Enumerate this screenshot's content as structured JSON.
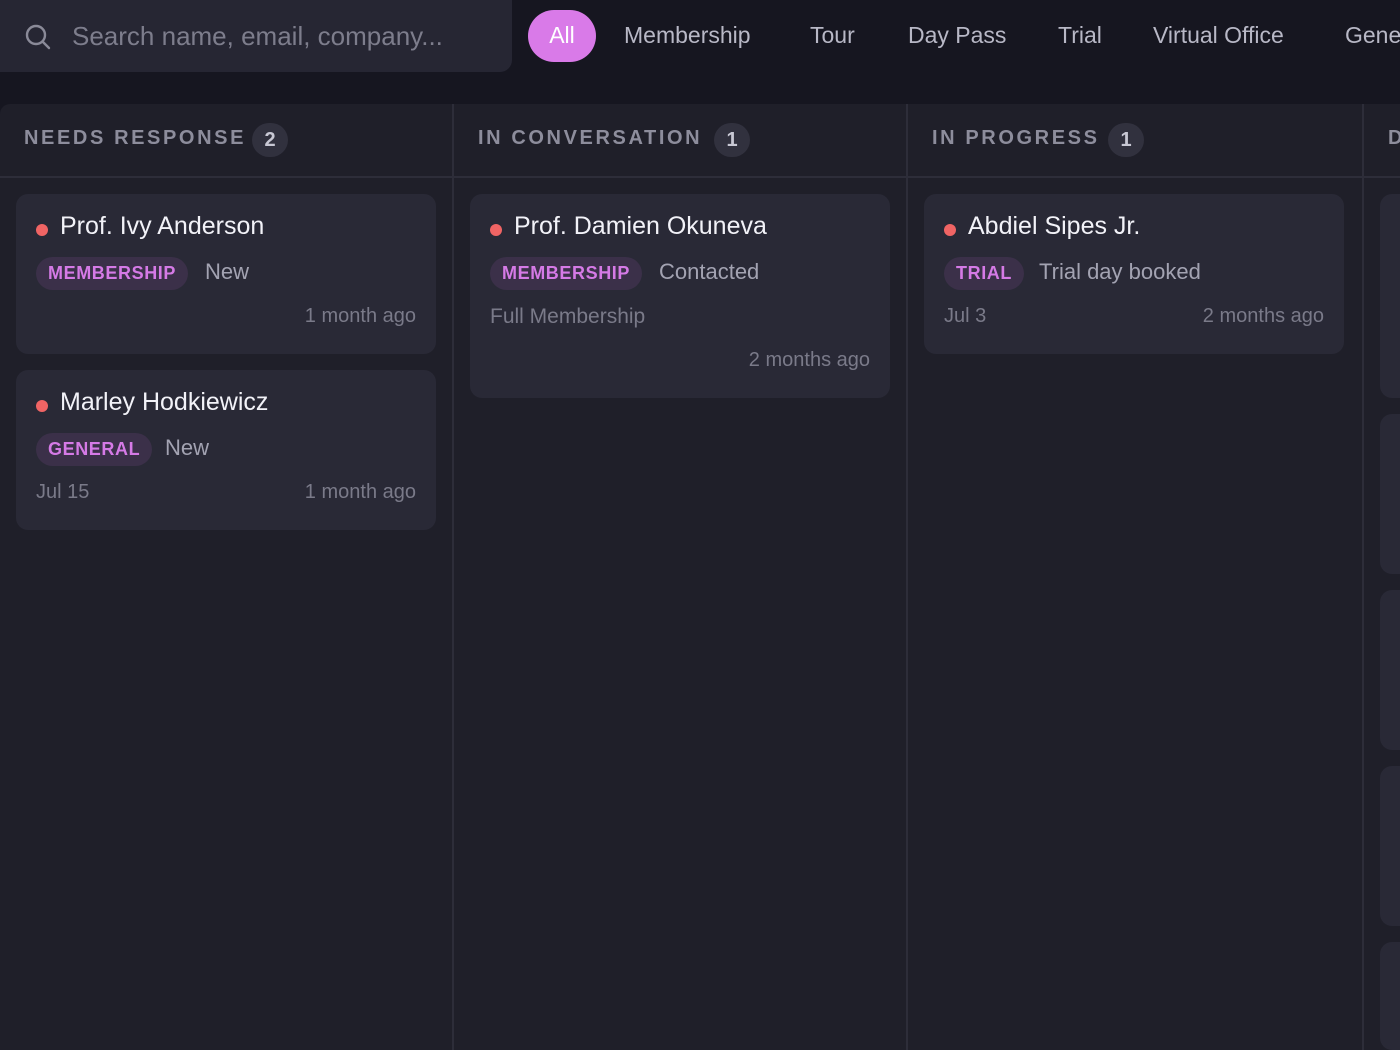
{
  "search": {
    "placeholder": "Search name, email, company..."
  },
  "filters": [
    "All",
    "Membership",
    "Tour",
    "Day Pass",
    "Trial",
    "Virtual Office",
    "Gene"
  ],
  "columns": [
    {
      "title": "NEEDS RESPONSE",
      "count": "2",
      "cards": [
        {
          "name": "Prof. Ivy Anderson",
          "tag": "MEMBERSHIP",
          "status": "New",
          "date": "",
          "ago": "1 month ago"
        },
        {
          "name": "Marley Hodkiewicz",
          "tag": "GENERAL",
          "status": "New",
          "date": "Jul 15",
          "ago": "1 month ago"
        }
      ]
    },
    {
      "title": "IN CONVERSATION",
      "count": "1",
      "cards": [
        {
          "name": "Prof. Damien Okuneva",
          "tag": "MEMBERSHIP",
          "status": "Contacted",
          "note": "Full Membership",
          "ago": "2 months ago"
        }
      ]
    },
    {
      "title": "IN PROGRESS",
      "count": "1",
      "cards": [
        {
          "name": "Abdiel Sipes Jr.",
          "tag": "TRIAL",
          "status": "Trial day booked",
          "date": "Jul 3",
          "ago": "2 months ago"
        }
      ]
    },
    {
      "title": "D"
    }
  ],
  "colors": {
    "accent": "#d97ae8",
    "unread_dot": "#f06464",
    "tag_text": "#d57ae6"
  },
  "icons": {
    "search": "search-icon"
  }
}
